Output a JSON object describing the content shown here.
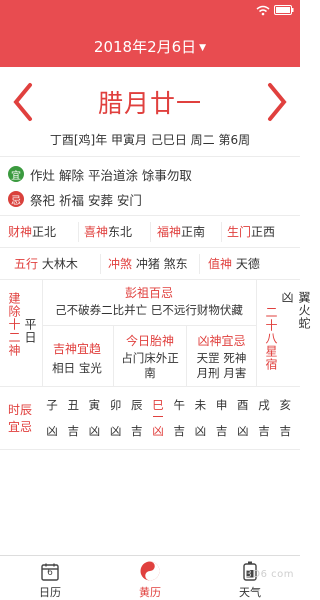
{
  "header": {
    "date": "2018年2月6日"
  },
  "lunar": {
    "date": "腊月廿一",
    "ganzhi": "丁酉[鸡]年 甲寅月 己巳日 周二 第6周"
  },
  "yiji": {
    "yi_badge": "宜",
    "yi_text": "作灶 解除 平治道涂 馀事勿取",
    "ji_badge": "忌",
    "ji_text": "祭祀 祈福 安葬 安门"
  },
  "gods": {
    "caishen_label": "财神",
    "caishen_value": "正北",
    "xishen_label": "喜神",
    "xishen_value": "东北",
    "fushen_label": "福神",
    "fushen_value": "正南",
    "shengmen_label": "生门",
    "shengmen_value": "正西",
    "wuxing_label": "五行",
    "wuxing_value": "大林木",
    "chongsha_label": "冲煞",
    "chongsha_value": "冲猪 煞东",
    "zhishen_label": "值神",
    "zhishen_value": "天德"
  },
  "details": {
    "jianchu_label": "建除十二神",
    "jianchu_value": "平日",
    "pengzu_label": "彭祖百忌",
    "pengzu_value": "己不破券二比并亡 巳不远行财物伏藏",
    "jishen_label": "吉神宜趋",
    "jishen_value": "相日 宝光",
    "taishen_label": "今日胎神",
    "taishen_value": "占门床外正南",
    "xiongshen_label": "凶神宜忌",
    "xiongshen_value": "天罡 死神 月刑 月害",
    "xingsu_label": "二十八星宿",
    "xingsu_value": "翼火蛇凶"
  },
  "hours": {
    "label": "时辰宜忌",
    "items": [
      {
        "branch": "子",
        "luck": "凶"
      },
      {
        "branch": "丑",
        "luck": "吉"
      },
      {
        "branch": "寅",
        "luck": "凶"
      },
      {
        "branch": "卯",
        "luck": "凶"
      },
      {
        "branch": "辰",
        "luck": "吉"
      },
      {
        "branch": "巳",
        "luck": "凶"
      },
      {
        "branch": "午",
        "luck": "吉"
      },
      {
        "branch": "未",
        "luck": "凶"
      },
      {
        "branch": "申",
        "luck": "吉"
      },
      {
        "branch": "酉",
        "luck": "凶"
      },
      {
        "branch": "戌",
        "luck": "吉"
      },
      {
        "branch": "亥",
        "luck": "吉"
      }
    ],
    "current_index": 5
  },
  "tabs": {
    "calendar_day": "6",
    "calendar_label": "日历",
    "almanac_label": "黄历",
    "weather_label": "天气"
  },
  "watermark": "3D6 com",
  "colors": {
    "header_bg": "#e84c50",
    "accent_red": "#e0403e",
    "yi_green": "#3b9a3f",
    "ji_red": "#d9413c"
  },
  "icons": {
    "wifi": "wifi-icon",
    "battery": "battery-icon",
    "prev": "chevron-left-icon",
    "next": "chevron-right-icon",
    "calendar": "calendar-icon",
    "almanac": "yin-yang-icon",
    "weather": "weather-icon"
  }
}
